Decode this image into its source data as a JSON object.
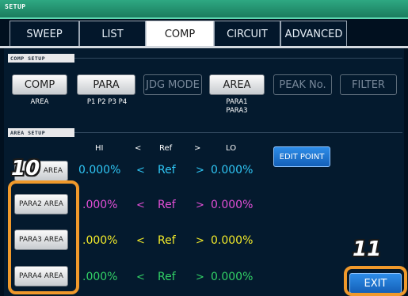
{
  "window": {
    "title": "SETUP"
  },
  "tabs": [
    {
      "label": "SWEEP",
      "active": false
    },
    {
      "label": "LIST",
      "active": false
    },
    {
      "label": "COMP",
      "active": true
    },
    {
      "label": "CIRCUIT",
      "active": false
    },
    {
      "label": "ADVANCED",
      "active": false
    }
  ],
  "comp_setup": {
    "header": "COMP SETUP",
    "buttons": [
      {
        "label": "COMP",
        "enabled": true,
        "sub": [
          "AREA"
        ]
      },
      {
        "label": "PARA",
        "enabled": true,
        "sub": [
          "P1 P2 P3 P4"
        ]
      },
      {
        "label": "JDG MODE",
        "enabled": false,
        "sub": []
      },
      {
        "label": "AREA",
        "enabled": true,
        "sub": [
          "PARA1",
          "PARA3"
        ]
      },
      {
        "label": "PEAK No.",
        "enabled": false,
        "sub": []
      },
      {
        "label": "FILTER",
        "enabled": false,
        "sub": []
      }
    ]
  },
  "area_setup": {
    "header": "AREA SETUP",
    "columns": {
      "hi": "HI",
      "lt": "<",
      "ref": "Ref",
      "gt": ">",
      "lo": "LO"
    },
    "edit_point_label": "EDIT POINT",
    "rows": [
      {
        "button": "PARA1 AREA",
        "button_visible": "AREA",
        "hi": "0.000%",
        "lt": "<",
        "ref": "Ref",
        "gt": ">",
        "lo": "0.000%",
        "color": "#2fc6f5"
      },
      {
        "button": "PARA2 AREA",
        "hi": ".000%",
        "lt": "<",
        "ref": "Ref",
        "gt": ">",
        "lo": "0.000%",
        "color": "#e24fd6"
      },
      {
        "button": "PARA3 AREA",
        "hi": ".000%",
        "lt": "<",
        "ref": "Ref",
        "gt": ">",
        "lo": "0.000%",
        "color": "#f2ea2a"
      },
      {
        "button": "PARA4 AREA",
        "hi": ".000%",
        "lt": "<",
        "ref": "Ref",
        "gt": ">",
        "lo": "0.000%",
        "color": "#32d166"
      }
    ]
  },
  "exit_label": "EXIT",
  "callouts": {
    "first": "10",
    "second": "11"
  },
  "colors": {
    "accent_orange": "#f0992b",
    "blue_button": "#1e7ad8"
  }
}
